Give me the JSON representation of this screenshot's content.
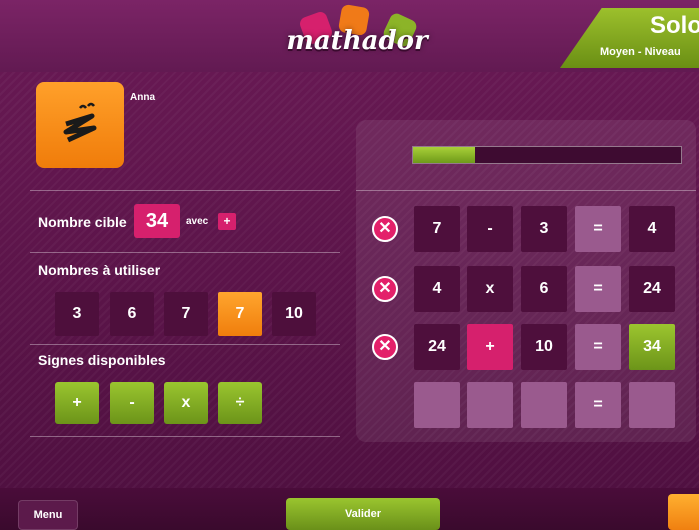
{
  "header": {
    "logo_text": "mathador",
    "mode_title": "Solo",
    "mode_subtitle": "Moyen - Niveau"
  },
  "player": {
    "name": "Anna",
    "avatar_icon": "zigzag-mascot-icon"
  },
  "target": {
    "label": "Nombre cible",
    "value": "34",
    "with_label": "avec",
    "with_sign": "+"
  },
  "numbers": {
    "label": "Nombres à utiliser",
    "items": [
      {
        "value": "3",
        "used": false
      },
      {
        "value": "6",
        "used": false
      },
      {
        "value": "7",
        "used": false
      },
      {
        "value": "7",
        "used": true
      },
      {
        "value": "10",
        "used": false
      }
    ]
  },
  "signs": {
    "label": "Signes disponibles",
    "items": [
      "+",
      "-",
      "x",
      "÷"
    ]
  },
  "progress": {
    "fraction": 0.23
  },
  "operations": [
    {
      "a": "7",
      "op": "-",
      "b": "3",
      "eq": "=",
      "result": "4"
    },
    {
      "a": "4",
      "op": "x",
      "b": "6",
      "eq": "=",
      "result": "24"
    },
    {
      "a": "24",
      "op": "+",
      "b": "10",
      "eq": "=",
      "result": "34"
    },
    {
      "a": "",
      "op": "",
      "b": "",
      "eq": "=",
      "result": ""
    }
  ],
  "delete_icon": "close-x-icon",
  "footer": {
    "menu_label": "Menu",
    "validate_label": "Valider",
    "corner_icon": "folder-icon"
  },
  "colors": {
    "background": "#5a1447",
    "accent_pink": "#d6206d",
    "accent_green": "#8cb428",
    "accent_orange": "#f5901a"
  }
}
